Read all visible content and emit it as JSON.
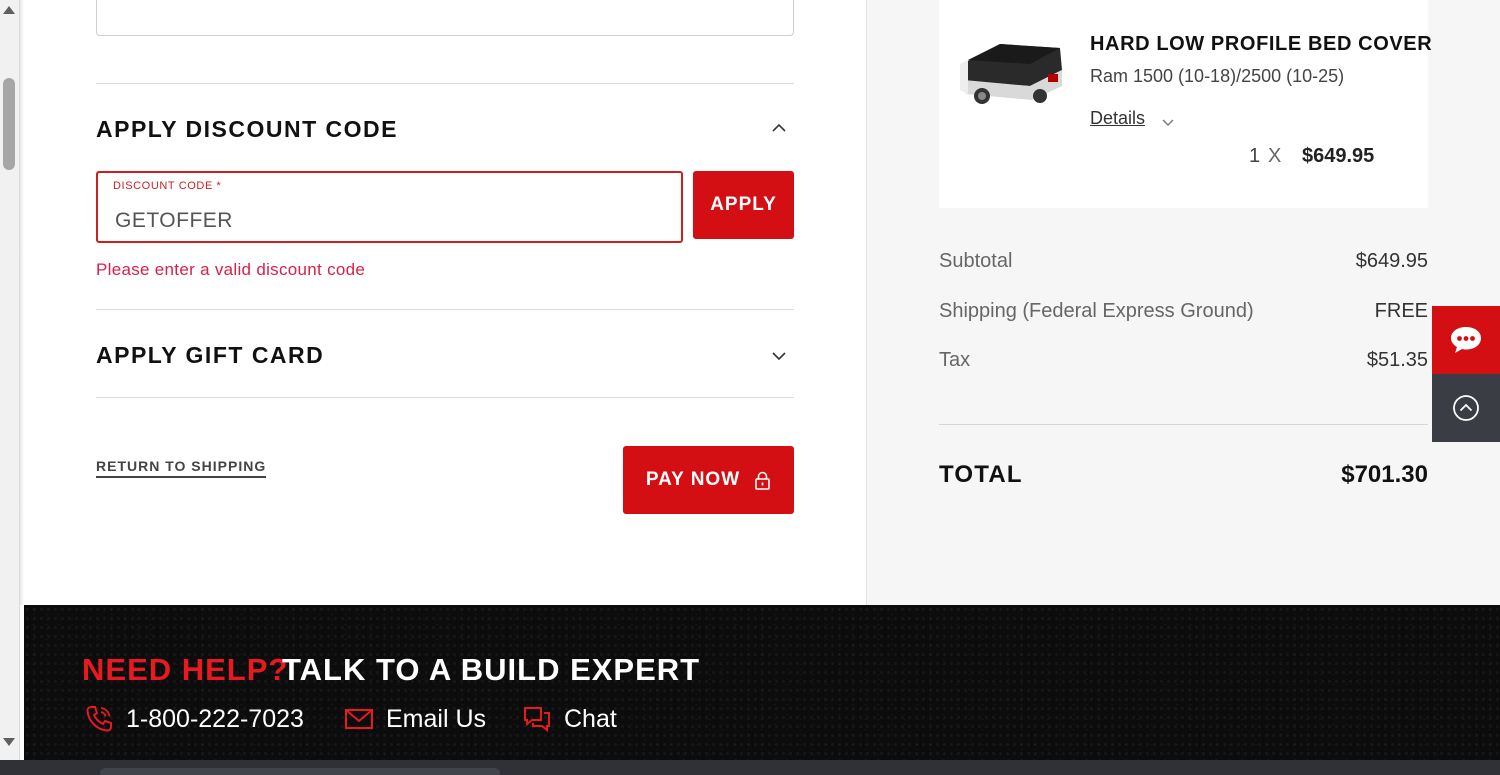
{
  "discount": {
    "title": "APPLY DISCOUNT CODE",
    "field_label": "DISCOUNT CODE *",
    "field_value": "GETOFFER",
    "apply_label": "APPLY",
    "error": "Please enter a valid discount code"
  },
  "gift_card": {
    "title": "APPLY GIFT CARD"
  },
  "actions": {
    "return_label": "RETURN TO SHIPPING",
    "pay_label": "PAY NOW"
  },
  "order": {
    "item": {
      "name": "HARD LOW PROFILE BED COVER",
      "fitment": "Ram 1500 (10-18)/2500 (10-25)",
      "details_label": "Details",
      "quantity": "1",
      "times": "X",
      "price": "$649.95"
    },
    "summary": {
      "subtotal_label": "Subtotal",
      "subtotal_value": "$649.95",
      "shipping_label": "Shipping (Federal Express Ground)",
      "shipping_value": "FREE",
      "tax_label": "Tax",
      "tax_value": "$51.35",
      "total_label": "TOTAL",
      "total_value": "$701.30"
    }
  },
  "footer": {
    "need_help": "NEED HELP?",
    "talk": "TALK TO A BUILD EXPERT",
    "phone": "1-800-222-7023",
    "email": "Email Us",
    "chat": "Chat"
  },
  "icons": {
    "phone": "phone-icon",
    "email": "envelope-icon",
    "chat": "chat-bubbles-icon",
    "lock": "lock-icon",
    "float_chat": "chat-icon",
    "back_to_top": "arrow-up-circle-icon"
  },
  "colors": {
    "brand_red": "#d40f14",
    "error_red": "#d8204a",
    "footer_bg": "#0c0c0c",
    "float_dark": "#3b3d44"
  }
}
